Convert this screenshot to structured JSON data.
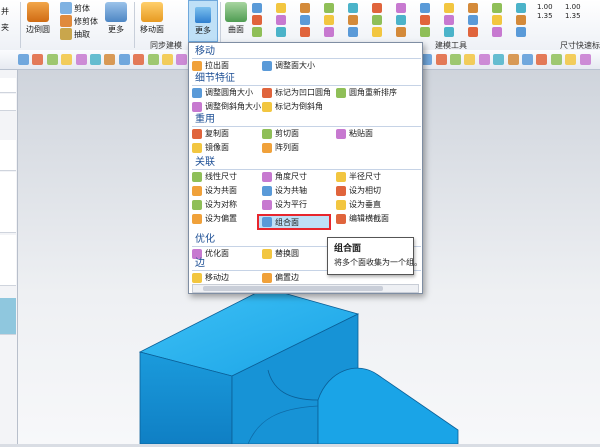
{
  "ribbon": {
    "cut_left_1": "并",
    "cut_left_2": "夹",
    "buttons": {
      "edge_face": "边倒圆",
      "trim_body": "修剪体",
      "extract": "抽取",
      "more_1": "更多",
      "move_face": "移动面",
      "more_2": "更多",
      "surface": "曲面",
      "cut_top": "剪体"
    },
    "groups": {
      "sync_modeling": "同步建模",
      "build_tools": "建模工具",
      "dimension_quick": "尺寸快速标"
    },
    "tiny_labels": [
      "1.00",
      "1.35",
      "1.00",
      "1.35"
    ]
  },
  "menu": {
    "sections": [
      {
        "title": "移动",
        "items": [
          "拉出面",
          "调整面大小"
        ]
      },
      {
        "title": "细节特征",
        "items": [
          "调整圆角大小",
          "标记为凹口圆角",
          "圆角重新排序",
          "调整倒斜角大小",
          "标记为倒斜角"
        ]
      },
      {
        "title": "重用",
        "items": [
          "复制面",
          "剪切面",
          "粘贴面",
          "镜像面",
          "阵列面"
        ]
      },
      {
        "title": "关联",
        "items": [
          "线性尺寸",
          "角度尺寸",
          "半径尺寸",
          "设为共面",
          "设为共轴",
          "设为相切",
          "设为对称",
          "设为平行",
          "设为垂直",
          "设为偏置",
          "组合面",
          "编辑横截面"
        ]
      },
      {
        "title": "优化",
        "items": [
          "优化面",
          "替换圆"
        ]
      },
      {
        "title": "边",
        "items": [
          "移动边",
          "偏置边"
        ]
      }
    ]
  },
  "tooltip": {
    "title": "组合面",
    "description": "将多个面收集为一个组。"
  },
  "colors": {
    "part_blue": "#1ea9ea",
    "highlight_border": "#e8262d",
    "header_blue": "#1d4f95",
    "selected_bg": "#bfe0f7"
  }
}
